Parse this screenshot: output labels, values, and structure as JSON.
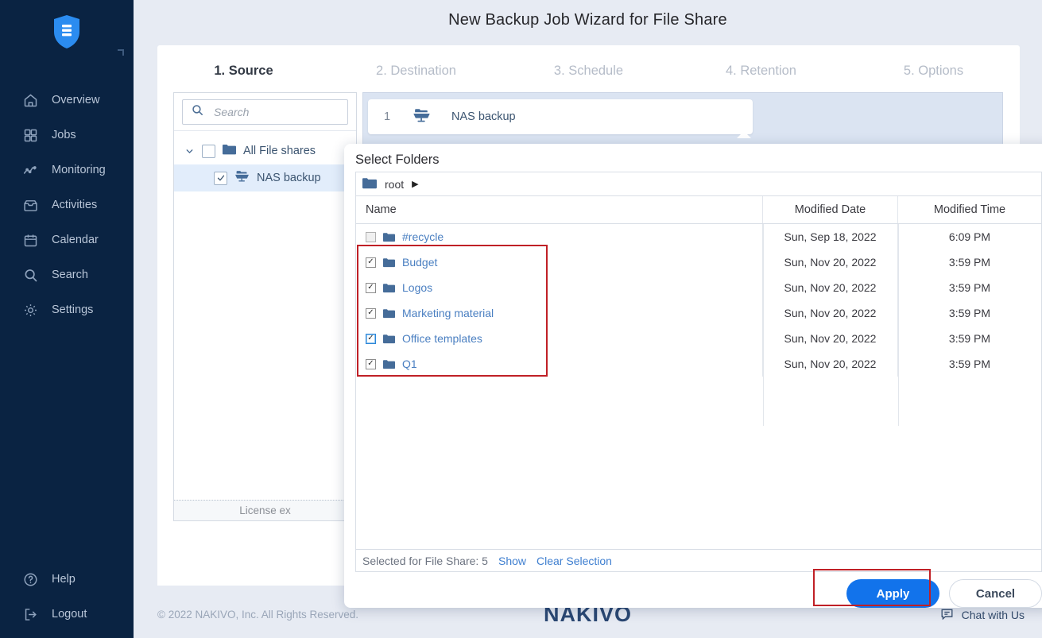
{
  "sidebar": {
    "logo_name": "nakivo-shield-logo",
    "items": [
      {
        "label": "Overview",
        "icon": "home-icon"
      },
      {
        "label": "Jobs",
        "icon": "grid-icon"
      },
      {
        "label": "Monitoring",
        "icon": "chart-line-icon"
      },
      {
        "label": "Activities",
        "icon": "inbox-icon"
      },
      {
        "label": "Calendar",
        "icon": "calendar-icon"
      },
      {
        "label": "Search",
        "icon": "search-icon"
      },
      {
        "label": "Settings",
        "icon": "gear-icon"
      }
    ],
    "bottom_items": [
      {
        "label": "Help",
        "icon": "question-circle-icon"
      },
      {
        "label": "Logout",
        "icon": "logout-icon"
      }
    ]
  },
  "wizard": {
    "title": "New Backup Job Wizard for File Share",
    "tabs": [
      {
        "label": "1. Source",
        "active": true
      },
      {
        "label": "2. Destination",
        "active": false
      },
      {
        "label": "3. Schedule",
        "active": false
      },
      {
        "label": "4. Retention",
        "active": false
      },
      {
        "label": "5. Options",
        "active": false
      }
    ],
    "search_placeholder": "Search",
    "tree": [
      {
        "label": "All File shares",
        "level": 0,
        "checked": false,
        "expanded": true,
        "icon": "folder-icon"
      },
      {
        "label": "NAS backup",
        "level": 1,
        "checked": true,
        "icon": "nas-share-icon"
      }
    ],
    "license_text": "License ex",
    "selected_card": {
      "index": "1",
      "label": "NAS backup",
      "icon": "nas-share-icon"
    }
  },
  "dialog": {
    "title": "Select Folders",
    "breadcrumb": {
      "label": "root",
      "icon": "folder-icon",
      "arrow": "▶"
    },
    "columns": [
      "Name",
      "Modified Date",
      "Modified Time"
    ],
    "rows": [
      {
        "name": "#recycle",
        "date": "Sun, Sep 18, 2022",
        "time": "6:09 PM",
        "checked": false,
        "focused": false
      },
      {
        "name": "Budget",
        "date": "Sun, Nov 20, 2022",
        "time": "3:59 PM",
        "checked": true,
        "focused": false
      },
      {
        "name": "Logos",
        "date": "Sun, Nov 20, 2022",
        "time": "3:59 PM",
        "checked": true,
        "focused": false
      },
      {
        "name": "Marketing material",
        "date": "Sun, Nov 20, 2022",
        "time": "3:59 PM",
        "checked": true,
        "focused": false
      },
      {
        "name": "Office templates",
        "date": "Sun, Nov 20, 2022",
        "time": "3:59 PM",
        "checked": true,
        "focused": true
      },
      {
        "name": "Q1",
        "date": "Sun, Nov 20, 2022",
        "time": "3:59 PM",
        "checked": true,
        "focused": false
      }
    ],
    "selection_label": "Selected for File Share: 5",
    "show_link": "Show",
    "clear_link": "Clear Selection",
    "apply_label": "Apply",
    "cancel_label": "Cancel"
  },
  "footer": {
    "copyright": "© 2022 NAKIVO, Inc. All Rights Reserved.",
    "brand": "NAKIVO",
    "chat_label": "Chat with Us",
    "chat_icon": "chat-icon"
  },
  "colors": {
    "sidebar_bg": "#0a2342",
    "accent_blue": "#1273eb",
    "link_blue": "#4a7fc1",
    "annotation_red": "#c02026",
    "page_bg": "#e7ebf3"
  }
}
